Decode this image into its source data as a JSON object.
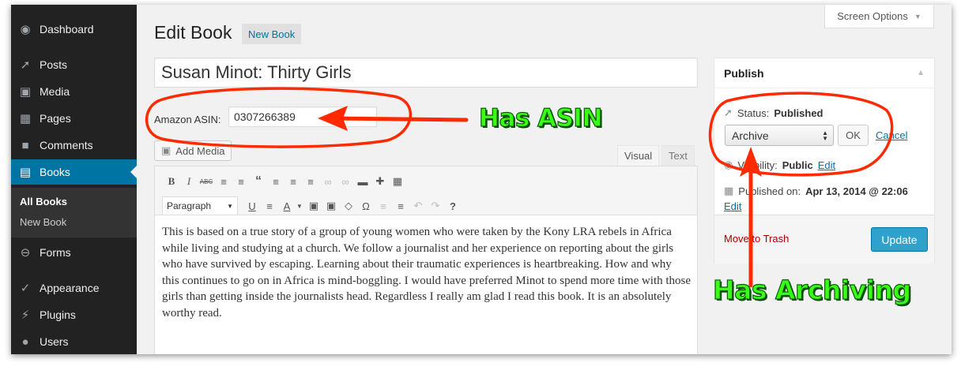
{
  "sidebar": {
    "items": [
      {
        "label": "Dashboard",
        "icon": "dashboard-icon"
      },
      {
        "label": "Posts",
        "icon": "pin-icon"
      },
      {
        "label": "Media",
        "icon": "media-icon"
      },
      {
        "label": "Pages",
        "icon": "pages-icon"
      },
      {
        "label": "Comments",
        "icon": "comment-icon"
      },
      {
        "label": "Books",
        "icon": "book-icon"
      },
      {
        "label": "Forms",
        "icon": "forms-icon"
      },
      {
        "label": "Appearance",
        "icon": "brush-icon"
      },
      {
        "label": "Plugins",
        "icon": "plug-icon"
      },
      {
        "label": "Users",
        "icon": "user-icon"
      }
    ],
    "submenu": [
      "All Books",
      "New Book"
    ]
  },
  "header": {
    "screen_options": "Screen Options",
    "title": "Edit Book",
    "new_button": "New Book"
  },
  "post": {
    "title": "Susan Minot: Thirty Girls",
    "asin_label": "Amazon ASIN:",
    "asin_value": "0307266389",
    "add_media": "Add Media",
    "tabs": {
      "visual": "Visual",
      "text": "Text"
    },
    "format_select": "Paragraph",
    "content": "This is based on a true story of a group of young women who were taken by the Kony LRA rebels in Africa while living and studying at a church. We follow a journalist and her experience on reporting about the girls who have survived by escaping. Learning about their traumatic experiences is heartbreaking. How and why this continues to go on in Africa is mind-boggling. I would have preferred Minot to spend more time with those girls than getting inside the journalists head. Regardless I really am glad I read this book. It is an absolutely worthy read."
  },
  "publish": {
    "title": "Publish",
    "status_label": "Status:",
    "status_value": "Published",
    "status_select": "Archive",
    "ok": "OK",
    "cancel": "Cancel",
    "visibility_label": "Visibility:",
    "visibility_value": "Public",
    "visibility_edit": "Edit",
    "published_label": "Published on:",
    "published_value": "Apr 13, 2014 @ 22:06",
    "published_edit": "Edit",
    "trash": "Move to Trash",
    "update": "Update"
  },
  "annotations": {
    "asin": "Has ASIN",
    "archiving": "Has Archiving",
    "color_red": "#ff2a00",
    "color_green": "#39ff14"
  }
}
